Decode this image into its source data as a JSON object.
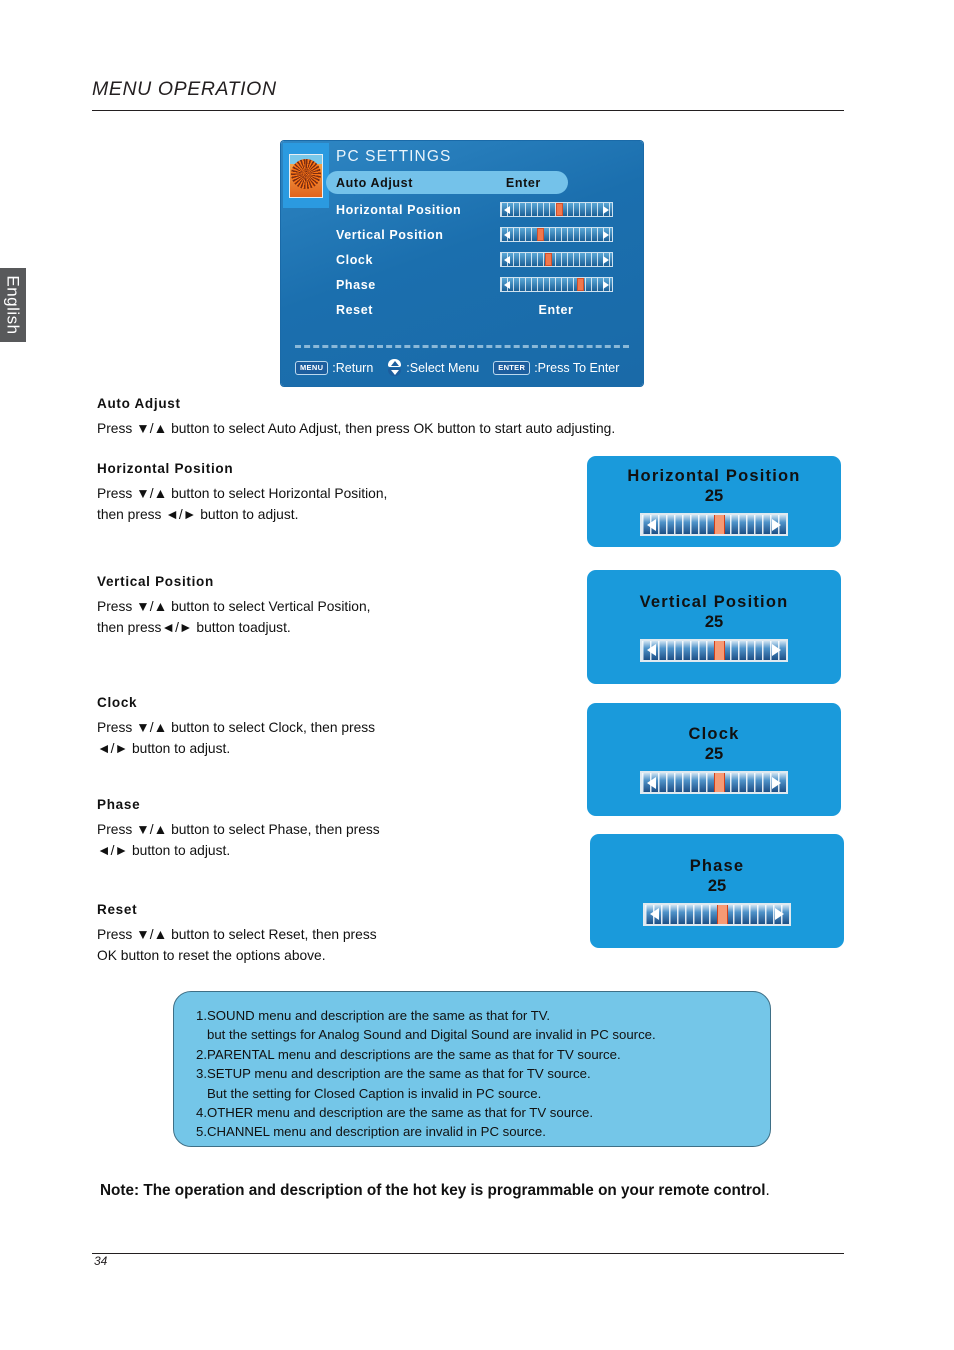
{
  "sidebar": {
    "language_label": "English"
  },
  "header": {
    "title": "MENU OPERATION"
  },
  "osd_menu": {
    "title": "PC SETTINGS",
    "thumbnail_icon": "flower-thumbnail-icon",
    "rows": [
      {
        "label": "Auto Adjust",
        "value": "Enter",
        "type": "action",
        "highlighted": true
      },
      {
        "label": "Horizontal Position",
        "value": "",
        "type": "slider",
        "highlighted": false,
        "thumb_pct": 50
      },
      {
        "label": "Vertical Position",
        "value": "",
        "type": "slider",
        "highlighted": false,
        "thumb_pct": 30
      },
      {
        "label": "Clock",
        "value": "",
        "type": "slider",
        "highlighted": false,
        "thumb_pct": 38
      },
      {
        "label": "Phase",
        "value": "",
        "type": "slider",
        "highlighted": false,
        "thumb_pct": 72
      },
      {
        "label": "Reset",
        "value": "Enter",
        "type": "action",
        "highlighted": false
      }
    ],
    "footer": {
      "menu_key": "MENU",
      "menu_text": ":Return",
      "updown_icon": "up-down-arrows-icon",
      "updown_text": ":Select Menu",
      "enter_key": "ENTER",
      "enter_text": ":Press To Enter"
    }
  },
  "sections": [
    {
      "heading": "Auto Adjust",
      "lines": [
        "Press ▼/▲ button to select Auto Adjust, then press OK button to start auto adjusting."
      ]
    },
    {
      "heading": "Horizontal Position",
      "lines": [
        "Press ▼/▲ button to select Horizontal Position,",
        "then press ◄/► button to adjust."
      ]
    },
    {
      "heading": "Vertical Position",
      "lines": [
        "Press ▼/▲ button to select Vertical Position,",
        "then press◄/► button toadjust."
      ]
    },
    {
      "heading": "Clock",
      "lines": [
        "Press ▼/▲ button to select Clock, then press",
        "◄/► button to adjust."
      ]
    },
    {
      "heading": "Phase",
      "lines": [
        "Press ▼/▲ button to select Phase, then press",
        "◄/► button to adjust."
      ]
    },
    {
      "heading": "Reset",
      "lines": [
        "Press ▼/▲ button to select Reset, then press",
        "OK button to reset the options above."
      ]
    }
  ],
  "popups": [
    {
      "title": "Horizontal Position",
      "value": "25",
      "thumb_pct": 50
    },
    {
      "title": "Vertical Position",
      "value": "25",
      "thumb_pct": 50
    },
    {
      "title": "Clock",
      "value": "25",
      "thumb_pct": 50
    },
    {
      "title": "Phase",
      "value": "25",
      "thumb_pct": 50
    }
  ],
  "notes": {
    "lines": [
      {
        "text": "1.SOUND menu and description are the same as that for TV.",
        "indent": false
      },
      {
        "text": "but the settings for Analog Sound and Digital Sound are invalid in PC source.",
        "indent": true
      },
      {
        "text": "2.PARENTAL menu and descriptions are the same as that for TV source.",
        "indent": false
      },
      {
        "text": "3.SETUP menu and description are the same as that for TV source.",
        "indent": false
      },
      {
        "text": "But the setting for Closed Caption is invalid in PC source.",
        "indent": true
      },
      {
        "text": "4.OTHER menu and description are the same as that for TV source.",
        "indent": false
      },
      {
        "text": "5.CHANNEL menu and description are invalid in PC source.",
        "indent": false
      }
    ]
  },
  "bottom_note": {
    "prefix": "Note",
    "body": ": The operation and description of the hot key is programmable on your remote control",
    "suffix": "."
  },
  "footer": {
    "page_number": "34"
  },
  "colors": {
    "osd_blue": "#1a6aa8",
    "popup_blue": "#1a9adb",
    "highlight_blue": "#74c2ea",
    "slider_thumb": "#f0784d",
    "notes_blue": "#74c6e8",
    "tab_gray": "#58595b"
  }
}
